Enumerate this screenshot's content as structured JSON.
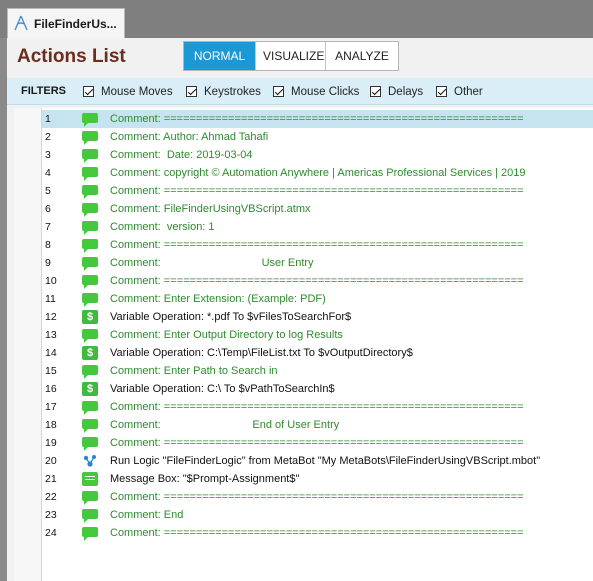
{
  "tab": {
    "title": "FileFinderUs..."
  },
  "header": {
    "title": "Actions List"
  },
  "modes": [
    {
      "label": "NORMAL",
      "active": true
    },
    {
      "label": "VISUALIZE",
      "active": false
    },
    {
      "label": "ANALYZE",
      "active": false
    }
  ],
  "filters": {
    "label": "FILTERS",
    "items": [
      {
        "label": "Mouse Moves",
        "checked": true
      },
      {
        "label": "Keystrokes",
        "checked": true
      },
      {
        "label": "Mouse Clicks",
        "checked": true
      },
      {
        "label": "Delays",
        "checked": true
      },
      {
        "label": "Other",
        "checked": true
      }
    ]
  },
  "colors": {
    "accent": "#1c98d4",
    "title": "#6b2d1e",
    "comment": "#2e8b2e",
    "selected_row": "#c6e4ef"
  },
  "actions": [
    {
      "line": "1",
      "icon": "comment-icon",
      "text": "Comment: ========================================================",
      "kind": "comment"
    },
    {
      "line": "2",
      "icon": "comment-icon",
      "text": "Comment: Author: Ahmad Tahafi",
      "kind": "comment"
    },
    {
      "line": "3",
      "icon": "comment-icon",
      "text": "Comment:  Date: 2019-03-04",
      "kind": "comment"
    },
    {
      "line": "4",
      "icon": "comment-icon",
      "text": "Comment: copyright © Automation Anywhere | Americas Professional Services | 2019",
      "kind": "comment"
    },
    {
      "line": "5",
      "icon": "comment-icon",
      "text": "Comment: ========================================================",
      "kind": "comment"
    },
    {
      "line": "6",
      "icon": "comment-icon",
      "text": "Comment: FileFinderUsingVBScript.atmx",
      "kind": "comment"
    },
    {
      "line": "7",
      "icon": "comment-icon",
      "text": "Comment:  version: 1",
      "kind": "comment"
    },
    {
      "line": "8",
      "icon": "comment-icon",
      "text": "Comment: ========================================================",
      "kind": "comment"
    },
    {
      "line": "9",
      "icon": "comment-icon",
      "text": "Comment:                                 User Entry",
      "kind": "comment"
    },
    {
      "line": "10",
      "icon": "comment-icon",
      "text": "Comment: ========================================================",
      "kind": "comment"
    },
    {
      "line": "11",
      "icon": "comment-icon",
      "text": "Comment: Enter Extension: (Example: PDF)",
      "kind": "comment"
    },
    {
      "line": "12",
      "icon": "variable-icon",
      "text": "Variable Operation: *.pdf To $vFilesToSearchFor$",
      "kind": "action"
    },
    {
      "line": "13",
      "icon": "comment-icon",
      "text": "Comment: Enter Output Directory to log Results",
      "kind": "comment"
    },
    {
      "line": "14",
      "icon": "variable-icon",
      "text": "Variable Operation: C:\\Temp\\FileList.txt To $vOutputDirectory$",
      "kind": "action"
    },
    {
      "line": "15",
      "icon": "comment-icon",
      "text": "Comment: Enter Path to Search in",
      "kind": "comment"
    },
    {
      "line": "16",
      "icon": "variable-icon",
      "text": "Variable Operation: C:\\ To $vPathToSearchIn$",
      "kind": "action"
    },
    {
      "line": "17",
      "icon": "comment-icon",
      "text": "Comment: ========================================================",
      "kind": "comment"
    },
    {
      "line": "18",
      "icon": "comment-icon",
      "text": "Comment:                              End of User Entry",
      "kind": "comment"
    },
    {
      "line": "19",
      "icon": "comment-icon",
      "text": "Comment: ========================================================",
      "kind": "comment"
    },
    {
      "line": "20",
      "icon": "metabot-icon",
      "text": "Run Logic \"FileFinderLogic\" from MetaBot \"My MetaBots\\FileFinderUsingVBScript.mbot\"",
      "kind": "action"
    },
    {
      "line": "21",
      "icon": "message-box-icon",
      "text": "Message Box: \"$Prompt-Assignment$\"",
      "kind": "action"
    },
    {
      "line": "22",
      "icon": "comment-icon",
      "text": "Comment: ========================================================",
      "kind": "comment"
    },
    {
      "line": "23",
      "icon": "comment-icon",
      "text": "Comment: End",
      "kind": "comment"
    },
    {
      "line": "24",
      "icon": "comment-icon",
      "text": "Comment: ========================================================",
      "kind": "comment"
    }
  ]
}
